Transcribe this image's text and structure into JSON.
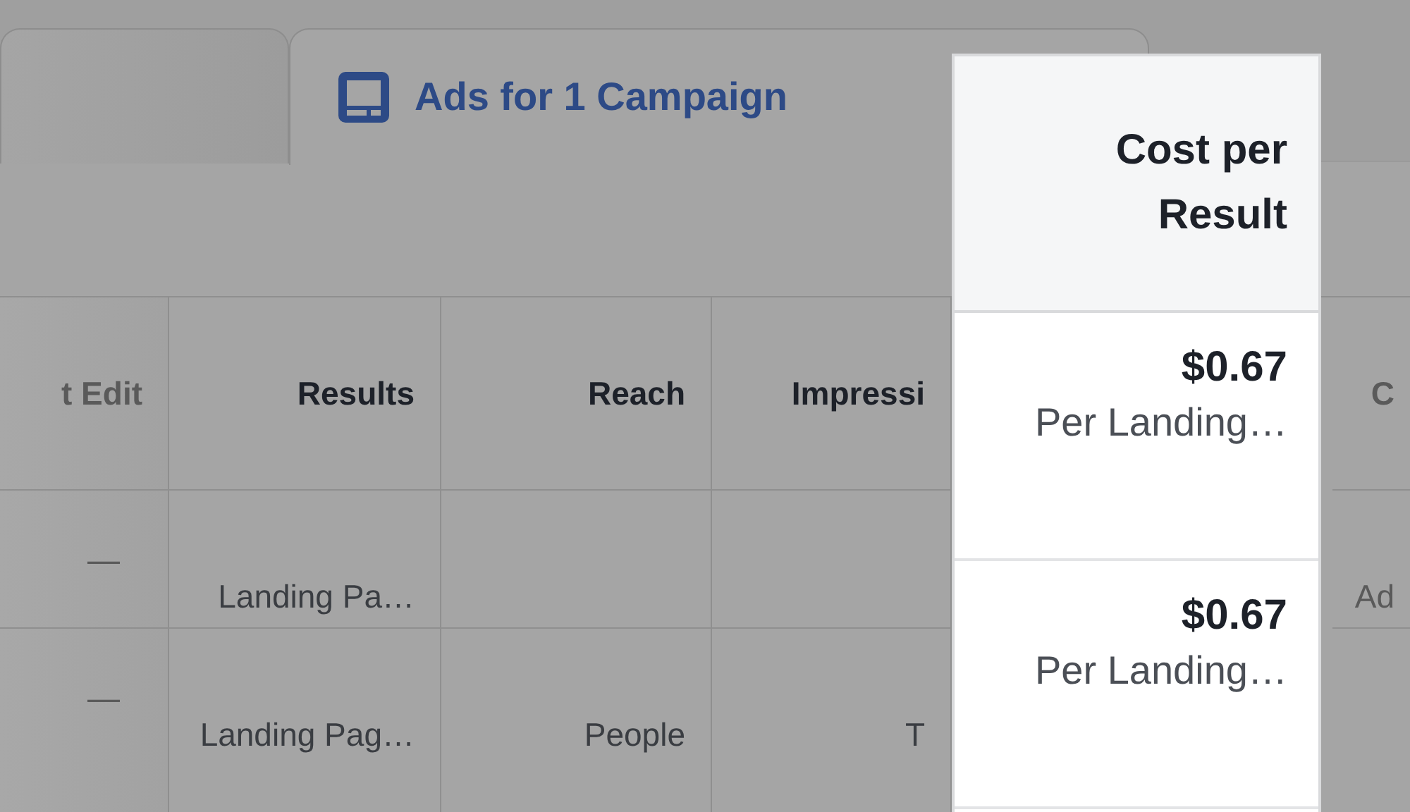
{
  "tabs": [
    {
      "selected": false
    },
    {
      "label": "Ads for 1 Campaign",
      "selected": true
    }
  ],
  "table": {
    "columns": [
      "t Edit",
      "Results",
      "Reach",
      "Impressi",
      "C"
    ],
    "rows": [
      [
        "—",
        "Landing Pa…",
        null,
        null,
        "Ad"
      ],
      [
        "—",
        "Landing Pag…",
        "People",
        "T",
        null
      ]
    ]
  },
  "highlight": {
    "header": "Cost per Result",
    "rows": [
      {
        "value": "$0.67",
        "label": "Per Landing…"
      },
      {
        "value": "$0.67",
        "label": "Per Landing…"
      }
    ]
  }
}
